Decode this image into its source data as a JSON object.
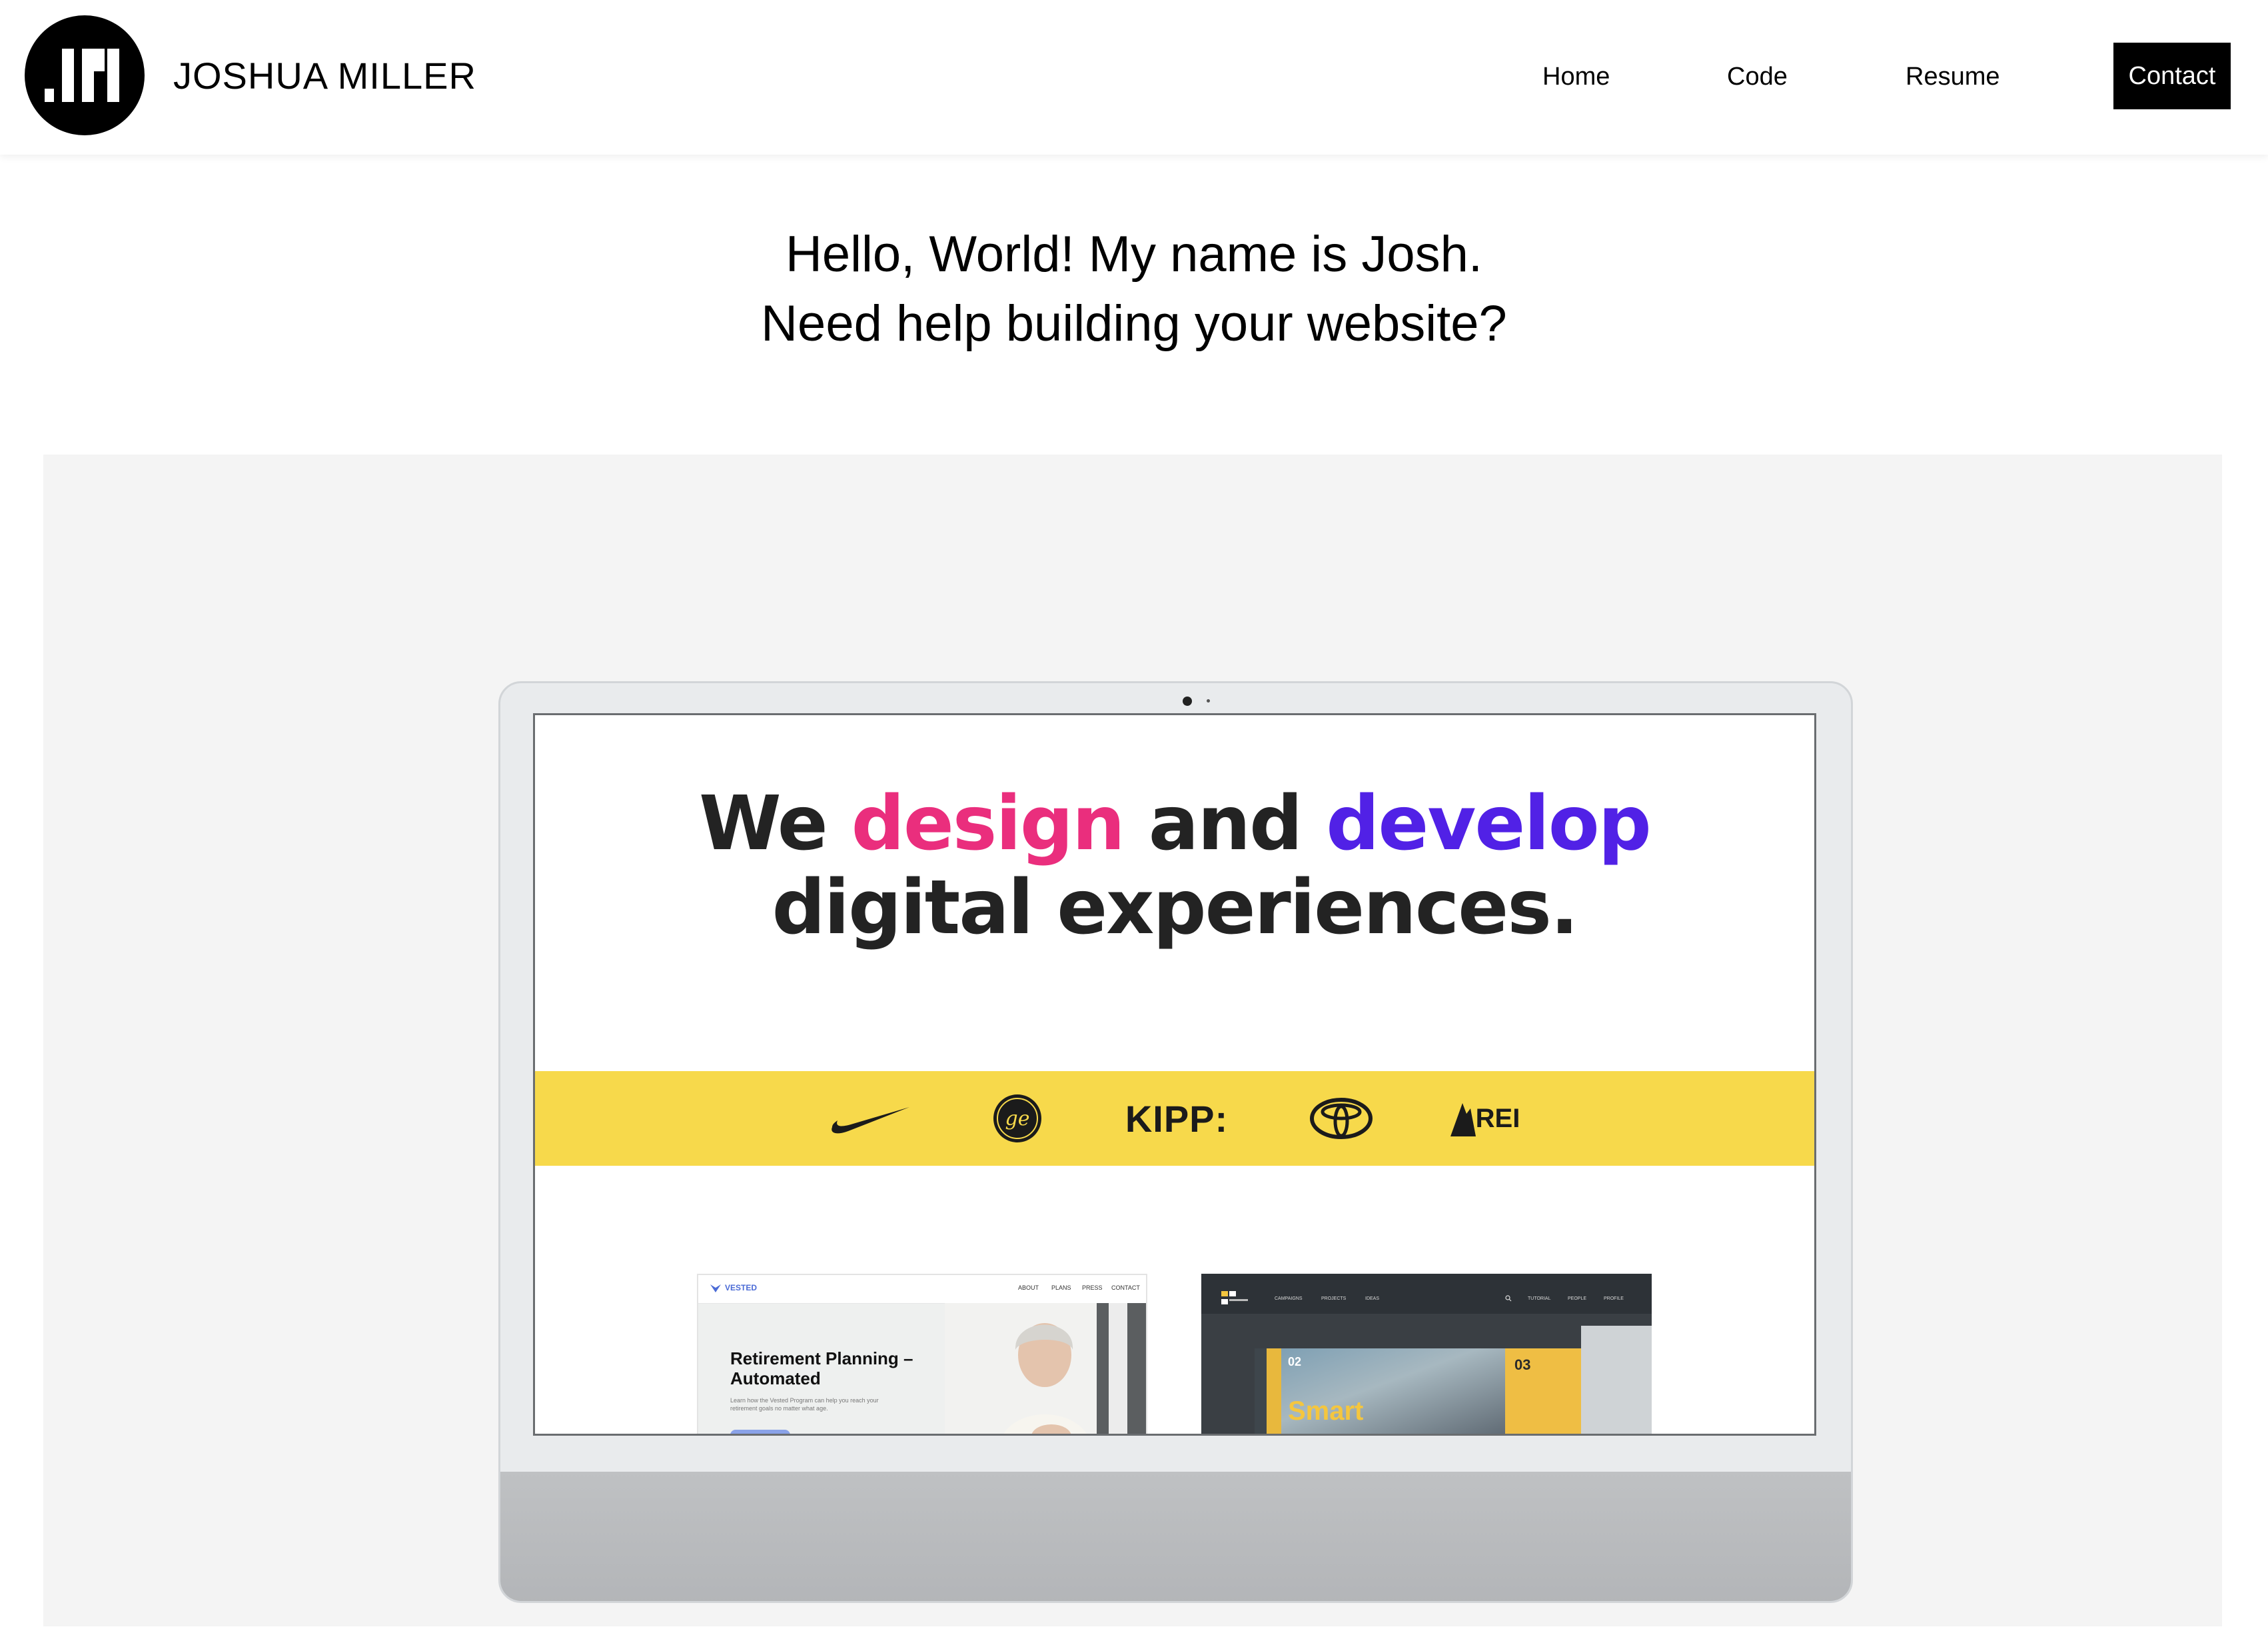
{
  "header": {
    "brand_name": "JOSHUA MILLER",
    "nav": {
      "home": "Home",
      "code": "Code",
      "resume": "Resume",
      "contact": "Contact"
    }
  },
  "hero": {
    "line1": "Hello, World! My name is Josh.",
    "line2": "Need help building your website?"
  },
  "showcase": {
    "headline": {
      "we": "We",
      "design": "design",
      "and": "and",
      "develop": "develop",
      "line2": "digital experiences."
    },
    "colors": {
      "pink": "#ea2e7d",
      "purple": "#5121e6",
      "band": "#f7d94b"
    },
    "clients": {
      "kipp": "KIPP:",
      "rei": "REI"
    },
    "thumb_vested": {
      "logo": "VESTED",
      "nav": [
        "ABOUT",
        "PLANS",
        "PRESS",
        "CONTACT"
      ],
      "title": "Retirement Planning – Automated",
      "subtitle": "Learn how the Vested Program can help you reach your retirement goals no matter what age."
    },
    "thumb_smart": {
      "nav": [
        "CAMPAIGNS",
        "PROJECTS",
        "IDEAS",
        "TUTORIAL",
        "PEOPLE",
        "PROFILE"
      ],
      "num_02": "02",
      "num_03": "03",
      "word": "Smart"
    }
  }
}
